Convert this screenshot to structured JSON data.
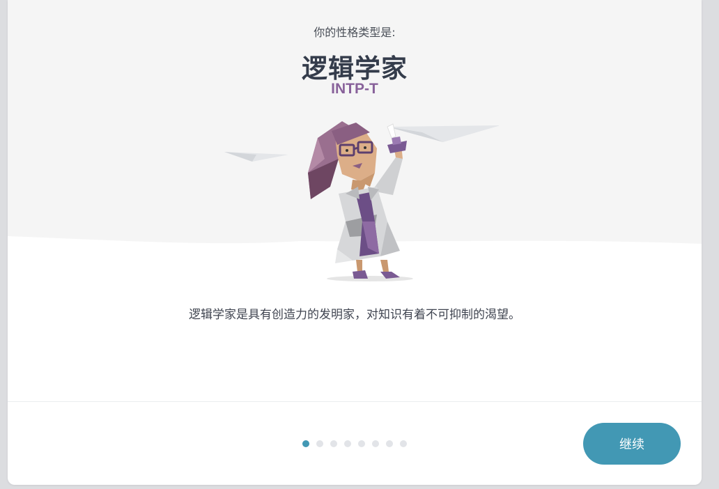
{
  "result": {
    "intro": "你的性格类型是:",
    "type_name": "逻辑学家",
    "type_code": "INTP-T",
    "description": "逻辑学家是具有创造力的发明家，对知识有着不可抑制的渴望。",
    "illustration_icon": "scientist-character-illustration"
  },
  "pager": {
    "total_pages": 8,
    "current_page": 1
  },
  "footer": {
    "continue_label": "继续"
  },
  "colors": {
    "accent": "#8e6ba3",
    "type_code": "#88619a",
    "button": "#4298b4",
    "hero_background": "#f5f5f5"
  }
}
